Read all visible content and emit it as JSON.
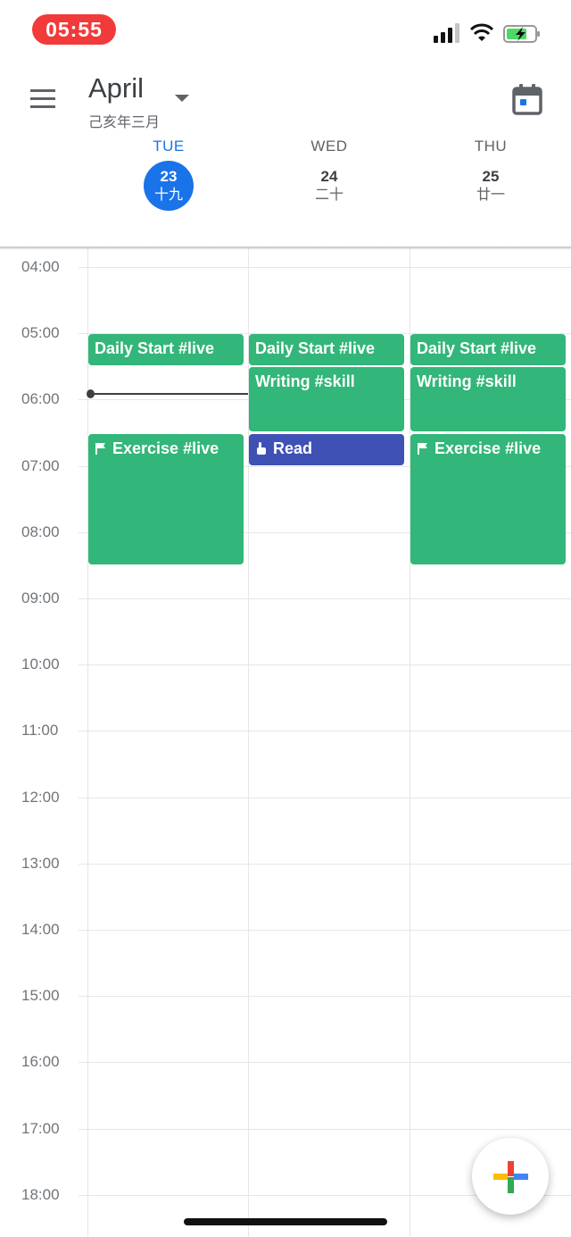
{
  "status_bar": {
    "time": "05:55",
    "signal_icon": "signal-bars-icon",
    "wifi_icon": "wifi-icon",
    "battery_icon": "battery-charging-icon"
  },
  "header": {
    "month": "April",
    "lunar_month": "己亥年三月",
    "menu_icon": "hamburger-menu-icon",
    "dropdown_icon": "caret-down-icon",
    "today_icon": "calendar-today-icon"
  },
  "days": [
    {
      "dow": "TUE",
      "date": "23",
      "lunar": "十九",
      "today": true
    },
    {
      "dow": "WED",
      "date": "24",
      "lunar": "二十",
      "today": false
    },
    {
      "dow": "THU",
      "date": "25",
      "lunar": "廿一",
      "today": false
    }
  ],
  "hours": [
    "04:00",
    "05:00",
    "06:00",
    "07:00",
    "08:00",
    "09:00",
    "10:00",
    "11:00",
    "12:00",
    "13:00",
    "14:00",
    "15:00",
    "16:00",
    "17:00",
    "18:00"
  ],
  "events": [
    {
      "day": 0,
      "title": "Daily Start #live",
      "start": "05:00",
      "end": "05:30",
      "color": "#33b679",
      "icon": ""
    },
    {
      "day": 0,
      "title": "Exercise #live",
      "start": "06:30",
      "end": "08:30",
      "color": "#33b679",
      "icon": "flag-icon"
    },
    {
      "day": 1,
      "title": "Daily Start #live",
      "start": "05:00",
      "end": "05:30",
      "color": "#33b679",
      "icon": ""
    },
    {
      "day": 1,
      "title": "Writing #skill",
      "start": "05:30",
      "end": "06:30",
      "color": "#33b679",
      "icon": ""
    },
    {
      "day": 1,
      "title": "Read",
      "start": "06:30",
      "end": "07:00",
      "color": "#3f51b5",
      "icon": "hand-pointer-icon"
    },
    {
      "day": 2,
      "title": "Daily Start #live",
      "start": "05:00",
      "end": "05:30",
      "color": "#33b679",
      "icon": ""
    },
    {
      "day": 2,
      "title": "Writing #skill",
      "start": "05:30",
      "end": "06:30",
      "color": "#33b679",
      "icon": ""
    },
    {
      "day": 2,
      "title": "Exercise #live",
      "start": "06:30",
      "end": "08:30",
      "color": "#33b679",
      "icon": "flag-icon"
    }
  ],
  "current_time": "05:55",
  "fab": {
    "icon": "plus-multicolor-icon"
  },
  "colors": {
    "accent": "#1a73e8",
    "event_green": "#33b679",
    "event_blue": "#3f51b5"
  }
}
